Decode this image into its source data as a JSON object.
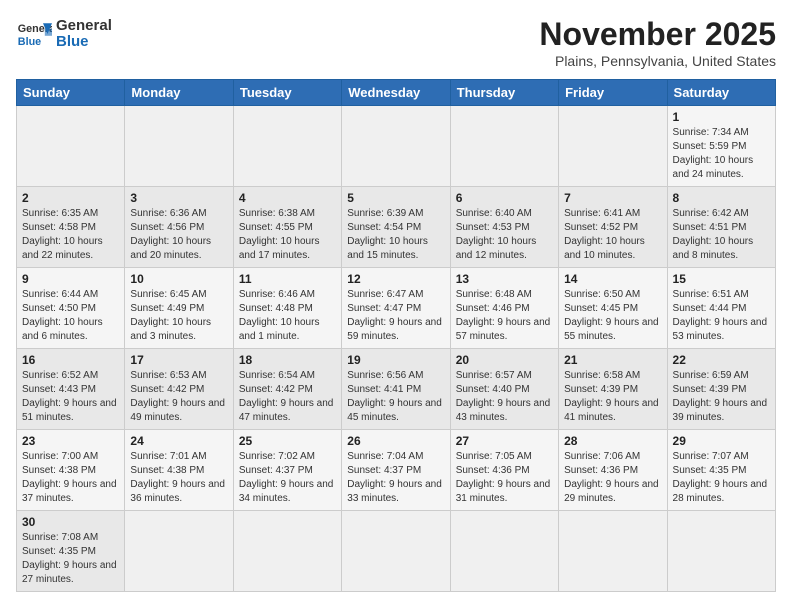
{
  "logo": {
    "line1": "General",
    "line2": "Blue"
  },
  "title": "November 2025",
  "subtitle": "Plains, Pennsylvania, United States",
  "weekdays": [
    "Sunday",
    "Monday",
    "Tuesday",
    "Wednesday",
    "Thursday",
    "Friday",
    "Saturday"
  ],
  "weeks": [
    [
      {
        "day": "",
        "info": ""
      },
      {
        "day": "",
        "info": ""
      },
      {
        "day": "",
        "info": ""
      },
      {
        "day": "",
        "info": ""
      },
      {
        "day": "",
        "info": ""
      },
      {
        "day": "",
        "info": ""
      },
      {
        "day": "1",
        "info": "Sunrise: 7:34 AM\nSunset: 5:59 PM\nDaylight: 10 hours and 24 minutes."
      }
    ],
    [
      {
        "day": "2",
        "info": "Sunrise: 6:35 AM\nSunset: 4:58 PM\nDaylight: 10 hours and 22 minutes."
      },
      {
        "day": "3",
        "info": "Sunrise: 6:36 AM\nSunset: 4:56 PM\nDaylight: 10 hours and 20 minutes."
      },
      {
        "day": "4",
        "info": "Sunrise: 6:38 AM\nSunset: 4:55 PM\nDaylight: 10 hours and 17 minutes."
      },
      {
        "day": "5",
        "info": "Sunrise: 6:39 AM\nSunset: 4:54 PM\nDaylight: 10 hours and 15 minutes."
      },
      {
        "day": "6",
        "info": "Sunrise: 6:40 AM\nSunset: 4:53 PM\nDaylight: 10 hours and 12 minutes."
      },
      {
        "day": "7",
        "info": "Sunrise: 6:41 AM\nSunset: 4:52 PM\nDaylight: 10 hours and 10 minutes."
      },
      {
        "day": "8",
        "info": "Sunrise: 6:42 AM\nSunset: 4:51 PM\nDaylight: 10 hours and 8 minutes."
      }
    ],
    [
      {
        "day": "9",
        "info": "Sunrise: 6:44 AM\nSunset: 4:50 PM\nDaylight: 10 hours and 6 minutes."
      },
      {
        "day": "10",
        "info": "Sunrise: 6:45 AM\nSunset: 4:49 PM\nDaylight: 10 hours and 3 minutes."
      },
      {
        "day": "11",
        "info": "Sunrise: 6:46 AM\nSunset: 4:48 PM\nDaylight: 10 hours and 1 minute."
      },
      {
        "day": "12",
        "info": "Sunrise: 6:47 AM\nSunset: 4:47 PM\nDaylight: 9 hours and 59 minutes."
      },
      {
        "day": "13",
        "info": "Sunrise: 6:48 AM\nSunset: 4:46 PM\nDaylight: 9 hours and 57 minutes."
      },
      {
        "day": "14",
        "info": "Sunrise: 6:50 AM\nSunset: 4:45 PM\nDaylight: 9 hours and 55 minutes."
      },
      {
        "day": "15",
        "info": "Sunrise: 6:51 AM\nSunset: 4:44 PM\nDaylight: 9 hours and 53 minutes."
      }
    ],
    [
      {
        "day": "16",
        "info": "Sunrise: 6:52 AM\nSunset: 4:43 PM\nDaylight: 9 hours and 51 minutes."
      },
      {
        "day": "17",
        "info": "Sunrise: 6:53 AM\nSunset: 4:42 PM\nDaylight: 9 hours and 49 minutes."
      },
      {
        "day": "18",
        "info": "Sunrise: 6:54 AM\nSunset: 4:42 PM\nDaylight: 9 hours and 47 minutes."
      },
      {
        "day": "19",
        "info": "Sunrise: 6:56 AM\nSunset: 4:41 PM\nDaylight: 9 hours and 45 minutes."
      },
      {
        "day": "20",
        "info": "Sunrise: 6:57 AM\nSunset: 4:40 PM\nDaylight: 9 hours and 43 minutes."
      },
      {
        "day": "21",
        "info": "Sunrise: 6:58 AM\nSunset: 4:39 PM\nDaylight: 9 hours and 41 minutes."
      },
      {
        "day": "22",
        "info": "Sunrise: 6:59 AM\nSunset: 4:39 PM\nDaylight: 9 hours and 39 minutes."
      }
    ],
    [
      {
        "day": "23",
        "info": "Sunrise: 7:00 AM\nSunset: 4:38 PM\nDaylight: 9 hours and 37 minutes."
      },
      {
        "day": "24",
        "info": "Sunrise: 7:01 AM\nSunset: 4:38 PM\nDaylight: 9 hours and 36 minutes."
      },
      {
        "day": "25",
        "info": "Sunrise: 7:02 AM\nSunset: 4:37 PM\nDaylight: 9 hours and 34 minutes."
      },
      {
        "day": "26",
        "info": "Sunrise: 7:04 AM\nSunset: 4:37 PM\nDaylight: 9 hours and 33 minutes."
      },
      {
        "day": "27",
        "info": "Sunrise: 7:05 AM\nSunset: 4:36 PM\nDaylight: 9 hours and 31 minutes."
      },
      {
        "day": "28",
        "info": "Sunrise: 7:06 AM\nSunset: 4:36 PM\nDaylight: 9 hours and 29 minutes."
      },
      {
        "day": "29",
        "info": "Sunrise: 7:07 AM\nSunset: 4:35 PM\nDaylight: 9 hours and 28 minutes."
      }
    ],
    [
      {
        "day": "30",
        "info": "Sunrise: 7:08 AM\nSunset: 4:35 PM\nDaylight: 9 hours and 27 minutes."
      },
      {
        "day": "",
        "info": ""
      },
      {
        "day": "",
        "info": ""
      },
      {
        "day": "",
        "info": ""
      },
      {
        "day": "",
        "info": ""
      },
      {
        "day": "",
        "info": ""
      },
      {
        "day": "",
        "info": ""
      }
    ]
  ],
  "colors": {
    "header_bg": "#2e6db4",
    "accent": "#1a6bb5"
  }
}
